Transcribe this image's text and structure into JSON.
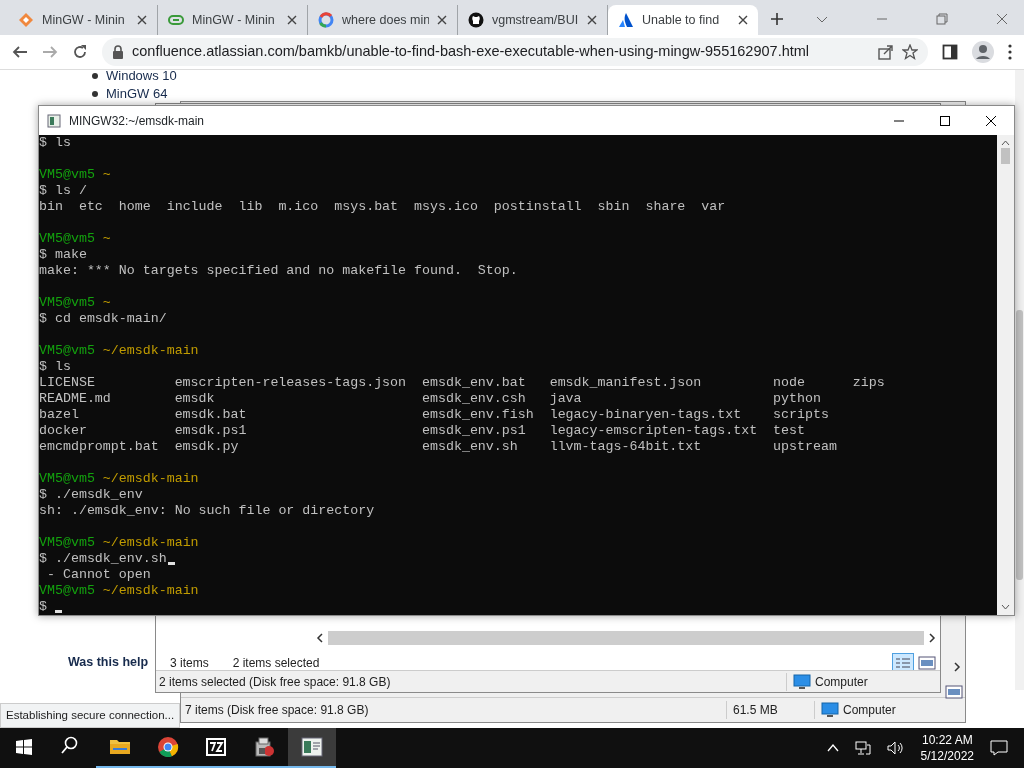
{
  "browser": {
    "tabs": [
      {
        "title": "MinGW - Minin",
        "kind": "diamond",
        "selected": false
      },
      {
        "title": "MinGW - Minin",
        "kind": "pill",
        "selected": false
      },
      {
        "title": "where does min",
        "kind": "ring",
        "selected": false
      },
      {
        "title": "vgmstream/BUI",
        "kind": "cat",
        "selected": false
      },
      {
        "title": "Unable to find",
        "kind": "triangle",
        "selected": true
      }
    ],
    "address": "confluence.atlassian.com/bamkb/unable-to-find-bash-exe-executable-when-using-mingw-955162907.html"
  },
  "page": {
    "list_items": [
      "Windows 10",
      "MinGW 64"
    ],
    "feedback_prompt": "Was this help",
    "status": "Establishing secure connection..."
  },
  "explorer_back": {
    "status": "7 items (Disk free space: 91.8 GB)",
    "size": "61.5 MB",
    "location": "Computer"
  },
  "explorer_front": {
    "item_count": "3 items",
    "selection": "2 items selected",
    "status": "2 items selected (Disk free space: 91.8 GB)",
    "location": "Computer"
  },
  "terminal": {
    "title": "MINGW32:~/emsdk-main",
    "lines": [
      {
        "kind": "cmd",
        "text": "$ ls",
        "cursor": false
      },
      {
        "kind": "blank"
      },
      {
        "kind": "prompt",
        "user": "VM5@vm5",
        "path": "~"
      },
      {
        "kind": "cmd",
        "text": "$ ls /",
        "cursor": false
      },
      {
        "kind": "output",
        "text": "bin  etc  home  include  lib  m.ico  msys.bat  msys.ico  postinstall  sbin  share  var"
      },
      {
        "kind": "blank"
      },
      {
        "kind": "prompt",
        "user": "VM5@vm5",
        "path": "~"
      },
      {
        "kind": "cmd",
        "text": "$ make",
        "cursor": false
      },
      {
        "kind": "output",
        "text": "make: *** No targets specified and no makefile found.  Stop."
      },
      {
        "kind": "blank"
      },
      {
        "kind": "prompt",
        "user": "VM5@vm5",
        "path": "~"
      },
      {
        "kind": "cmd",
        "text": "$ cd emsdk-main/",
        "cursor": false
      },
      {
        "kind": "blank"
      },
      {
        "kind": "prompt",
        "user": "VM5@vm5",
        "path": "~/emsdk-main"
      },
      {
        "kind": "cmd",
        "text": "$ ls",
        "cursor": false
      },
      {
        "kind": "columns",
        "cells": [
          "LICENSE",
          "emscripten-releases-tags.json",
          "emsdk_env.bat",
          "emsdk_manifest.json",
          "node",
          "zips"
        ]
      },
      {
        "kind": "columns",
        "cells": [
          "README.md",
          "emsdk",
          "emsdk_env.csh",
          "java",
          "python"
        ]
      },
      {
        "kind": "columns",
        "cells": [
          "bazel",
          "emsdk.bat",
          "emsdk_env.fish",
          "legacy-binaryen-tags.txt",
          "scripts"
        ]
      },
      {
        "kind": "columns",
        "cells": [
          "docker",
          "emsdk.ps1",
          "emsdk_env.ps1",
          "legacy-emscripten-tags.txt",
          "test"
        ]
      },
      {
        "kind": "columns",
        "cells": [
          "emcmdprompt.bat",
          "emsdk.py",
          "emsdk_env.sh",
          "llvm-tags-64bit.txt",
          "upstream"
        ]
      },
      {
        "kind": "blank"
      },
      {
        "kind": "prompt",
        "user": "VM5@vm5",
        "path": "~/emsdk-main"
      },
      {
        "kind": "cmd",
        "text": "$ ./emsdk_env",
        "cursor": false
      },
      {
        "kind": "output",
        "text": "sh: ./emsdk_env: No such file or directory"
      },
      {
        "kind": "blank"
      },
      {
        "kind": "prompt",
        "user": "VM5@vm5",
        "path": "~/emsdk-main"
      },
      {
        "kind": "cmd",
        "text": "$ ./emsdk_env.sh",
        "cursor": true
      },
      {
        "kind": "output",
        "text": " - Cannot open"
      },
      {
        "kind": "prompt",
        "user": "VM5@vm5",
        "path": "~/emsdk-main"
      },
      {
        "kind": "cmd",
        "text": "$",
        "cursor": true
      }
    ]
  },
  "taskbar": {
    "apps": [
      {
        "kind": "search",
        "running": false,
        "selected": false
      },
      {
        "kind": "folder",
        "running": true,
        "selected": false
      },
      {
        "kind": "chrome",
        "running": true,
        "selected": false
      },
      {
        "kind": "archiver",
        "running": true,
        "selected": false
      },
      {
        "kind": "installer",
        "running": true,
        "selected": false
      },
      {
        "kind": "terminal",
        "running": true,
        "selected": true
      }
    ],
    "time": "10:22 AM",
    "date": "5/12/2022"
  }
}
